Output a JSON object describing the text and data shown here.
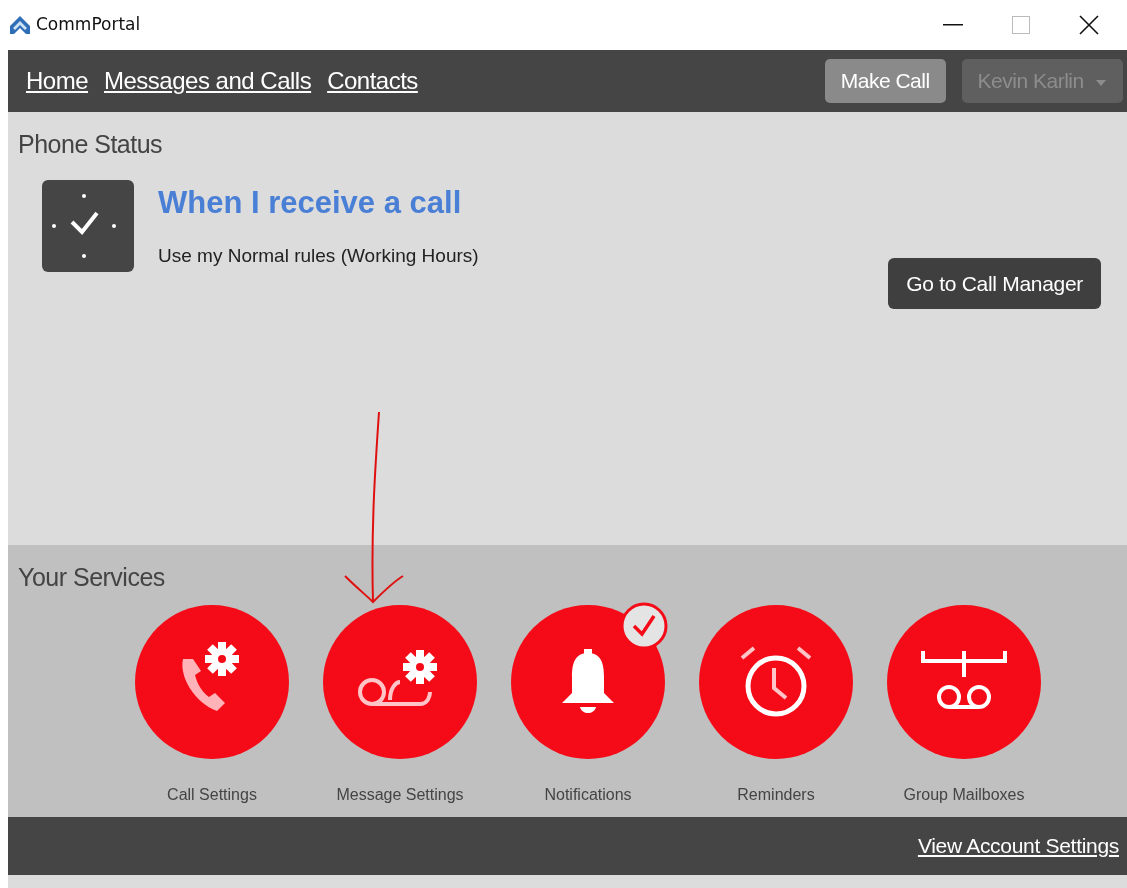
{
  "window": {
    "title": "CommPortal"
  },
  "nav": {
    "links": [
      {
        "label": "Home"
      },
      {
        "label": "Messages and Calls"
      },
      {
        "label": "Contacts"
      }
    ],
    "make_call": "Make Call",
    "user_menu": {
      "label": "Kevin Karlin",
      "disabled": true
    }
  },
  "phone_status": {
    "heading": "Phone Status",
    "title": "When I receive a call",
    "description": "Use my Normal rules (Working Hours)",
    "button": "Go to Call Manager"
  },
  "services": {
    "heading": "Your Services",
    "items": [
      {
        "label": "Call Settings",
        "checked": false
      },
      {
        "label": "Message Settings",
        "checked": false
      },
      {
        "label": "Notifications",
        "checked": true
      },
      {
        "label": "Reminders",
        "checked": false
      },
      {
        "label": "Group Mailboxes",
        "checked": false
      }
    ]
  },
  "footer": {
    "link": "View Account Settings"
  }
}
